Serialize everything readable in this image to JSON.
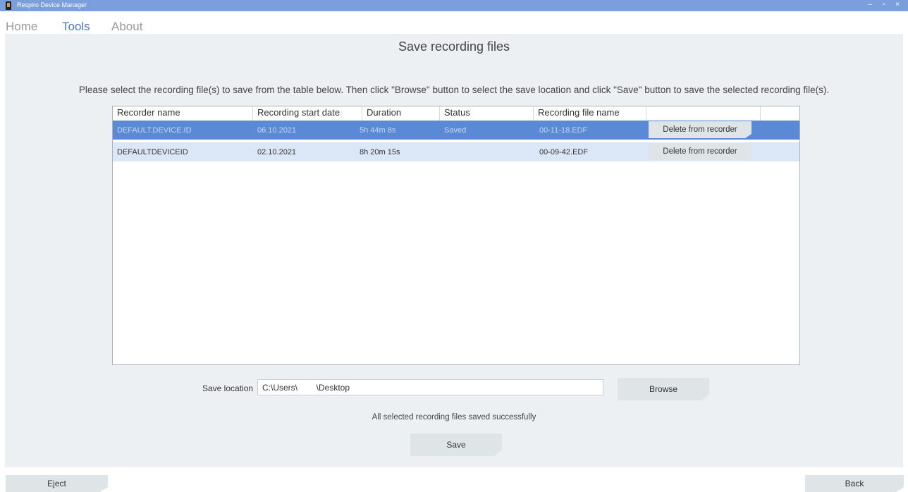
{
  "window": {
    "title": "Respiro Device Manager",
    "controls": "– ▫ ×"
  },
  "menu": {
    "items": [
      "Home",
      "Tools",
      "About"
    ],
    "active": "Tools"
  },
  "page": {
    "title": "Save recording files",
    "instruction": "Please select the recording file(s) to save from the table below. Then click \"Browse\" button to select the save location and click \"Save\" button to save the selected recording file(s)."
  },
  "table": {
    "headers": [
      "Recorder name",
      "Recording start date",
      "Duration",
      "Status",
      "Recording file name"
    ],
    "rows": [
      {
        "recorder": "DEFAULT.DEVICE.ID",
        "date": "06.10.2021",
        "duration": "5h  44m  8s",
        "status": "Saved",
        "file": "00-11-18.EDF",
        "action": "Delete from recorder",
        "selected": true
      },
      {
        "recorder": "DEFAULTDEVICEID",
        "date": "02.10.2021",
        "duration": "8h  20m  15s",
        "status": "",
        "file": "00-09-42.EDF",
        "action": "Delete from recorder",
        "selected": false
      }
    ]
  },
  "save": {
    "location_label": "Save location",
    "location_value": "C:\\Users\\        \\Desktop",
    "browse_label": "Browse",
    "status_message": "All selected recording files saved successfully",
    "save_label": "Save"
  },
  "footer": {
    "eject_label": "Eject",
    "back_label": "Back"
  },
  "colors": {
    "accent": "#7b9fdc",
    "selected_row": "#5a8ad6",
    "alt_row": "#dbe7f6",
    "panel": "#edf0f3"
  }
}
